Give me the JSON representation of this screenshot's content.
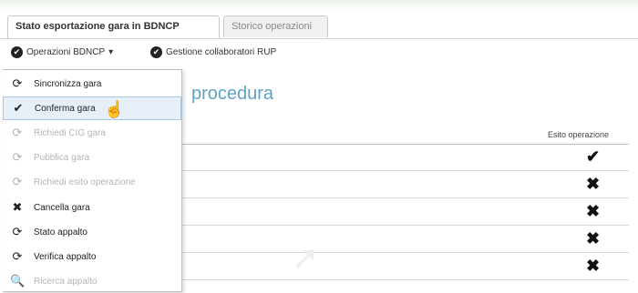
{
  "tabs": [
    {
      "label": "Stato esportazione gara in BDNCP"
    },
    {
      "label": "Storico operazioni"
    }
  ],
  "toolbar": {
    "item1_label": "Operazioni BDNCP",
    "item1_caret": "▾",
    "item2_label": "Gestione collaboratori RUP"
  },
  "main": {
    "title": "procedura",
    "column_header": "Esito operazione",
    "rows": [
      {
        "status": "✔"
      },
      {
        "status": "✖"
      },
      {
        "status": "✖"
      },
      {
        "status": "✖"
      },
      {
        "status": "✖"
      }
    ]
  },
  "menu": {
    "items": [
      {
        "label": "Sincronizza gara",
        "icon": "refresh-icon",
        "glyph": "⟳",
        "enabled": true
      },
      {
        "label": "Conferma gara",
        "icon": "check-icon",
        "glyph": "✔",
        "enabled": true,
        "hover": true
      },
      {
        "label": "Richiedi CIG gara",
        "icon": "refresh-icon",
        "glyph": "⟳",
        "enabled": false
      },
      {
        "label": "Pubblica gara",
        "icon": "refresh-icon",
        "glyph": "⟳",
        "enabled": false
      },
      {
        "label": "Richiedi esito operazione",
        "icon": "refresh-icon",
        "glyph": "⟳",
        "enabled": false
      },
      {
        "label": "Cancella gara",
        "icon": "close-icon",
        "glyph": "✖",
        "enabled": true
      },
      {
        "label": "Stato appalto",
        "icon": "refresh-icon",
        "glyph": "⟳",
        "enabled": true
      },
      {
        "label": "Verifica appalto",
        "icon": "refresh-icon",
        "glyph": "⟳",
        "enabled": true
      },
      {
        "label": "Ricerca appalto",
        "icon": "search-icon",
        "glyph": "🔍",
        "enabled": false
      }
    ]
  }
}
